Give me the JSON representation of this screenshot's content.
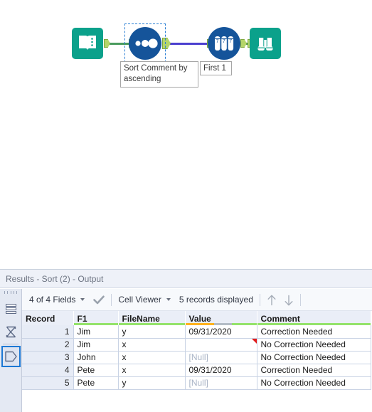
{
  "canvas": {
    "nodes": [
      {
        "id": "input-data",
        "icon": "book-icon",
        "label": "Input Data tool"
      },
      {
        "id": "sort",
        "icon": "sort-dots-icon",
        "label": "Sort tool",
        "selected": true
      },
      {
        "id": "sample",
        "icon": "test-tubes-icon",
        "label": "Sample tool"
      },
      {
        "id": "browse",
        "icon": "binoculars-icon",
        "label": "Browse tool"
      }
    ],
    "annotations": [
      {
        "id": "sort-annotation",
        "text": "Sort Comment by ascending"
      },
      {
        "id": "sample-annotation",
        "text": "First 1"
      }
    ],
    "colors": {
      "tool_teal": "#0ba18b",
      "tool_blue": "#15549a",
      "connector_green": "#4a9b5e",
      "connector_purple": "#4b3fcf",
      "selection": "#2b7fd4"
    }
  },
  "results": {
    "title": "Results - Sort (2) - Output",
    "toolbar": {
      "fields_label": "4 of 4 Fields",
      "cell_viewer_label": "Cell Viewer",
      "records_label": "5 records displayed",
      "check_icon": "checkmark-icon",
      "up_icon": "arrow-up-icon",
      "down_icon": "arrow-down-icon"
    },
    "rail": {
      "items": [
        {
          "id": "rows-view",
          "icon": "rows-icon",
          "selected": false
        },
        {
          "id": "summary-view",
          "icon": "sigma-icon",
          "selected": false
        },
        {
          "id": "metadata-view",
          "icon": "pentagon-icon",
          "selected": true
        }
      ]
    },
    "table": {
      "columns": [
        {
          "key": "record",
          "label": "Record",
          "quality": []
        },
        {
          "key": "f1",
          "label": "F1",
          "quality": [
            {
              "color": "#94e36b",
              "pct": 100
            }
          ]
        },
        {
          "key": "filename",
          "label": "FileName",
          "quality": [
            {
              "color": "#94e36b",
              "pct": 100
            }
          ]
        },
        {
          "key": "value",
          "label": "Value",
          "quality": [
            {
              "color": "#ffb21e",
              "pct": 40
            },
            {
              "color": "#b4bcc6",
              "pct": 25
            },
            {
              "color": "#94e36b",
              "pct": 35
            }
          ]
        },
        {
          "key": "comment",
          "label": "Comment",
          "quality": [
            {
              "color": "#94e36b",
              "pct": 100
            }
          ]
        }
      ],
      "rows": [
        {
          "record": "1",
          "f1": "Jim",
          "filename": "y",
          "value": "09/31/2020",
          "value_null": false,
          "value_flagged": false,
          "comment": "Correction Needed"
        },
        {
          "record": "2",
          "f1": "Jim",
          "filename": "x",
          "value": "",
          "value_null": false,
          "value_flagged": true,
          "comment": "No Correction Needed"
        },
        {
          "record": "3",
          "f1": "John",
          "filename": "x",
          "value": "[Null]",
          "value_null": true,
          "value_flagged": false,
          "comment": "No Correction Needed"
        },
        {
          "record": "4",
          "f1": "Pete",
          "filename": "x",
          "value": "09/31/2020",
          "value_null": false,
          "value_flagged": false,
          "comment": "Correction Needed"
        },
        {
          "record": "5",
          "f1": "Pete",
          "filename": "y",
          "value": "[Null]",
          "value_null": true,
          "value_flagged": false,
          "comment": "No Correction Needed"
        }
      ]
    }
  }
}
